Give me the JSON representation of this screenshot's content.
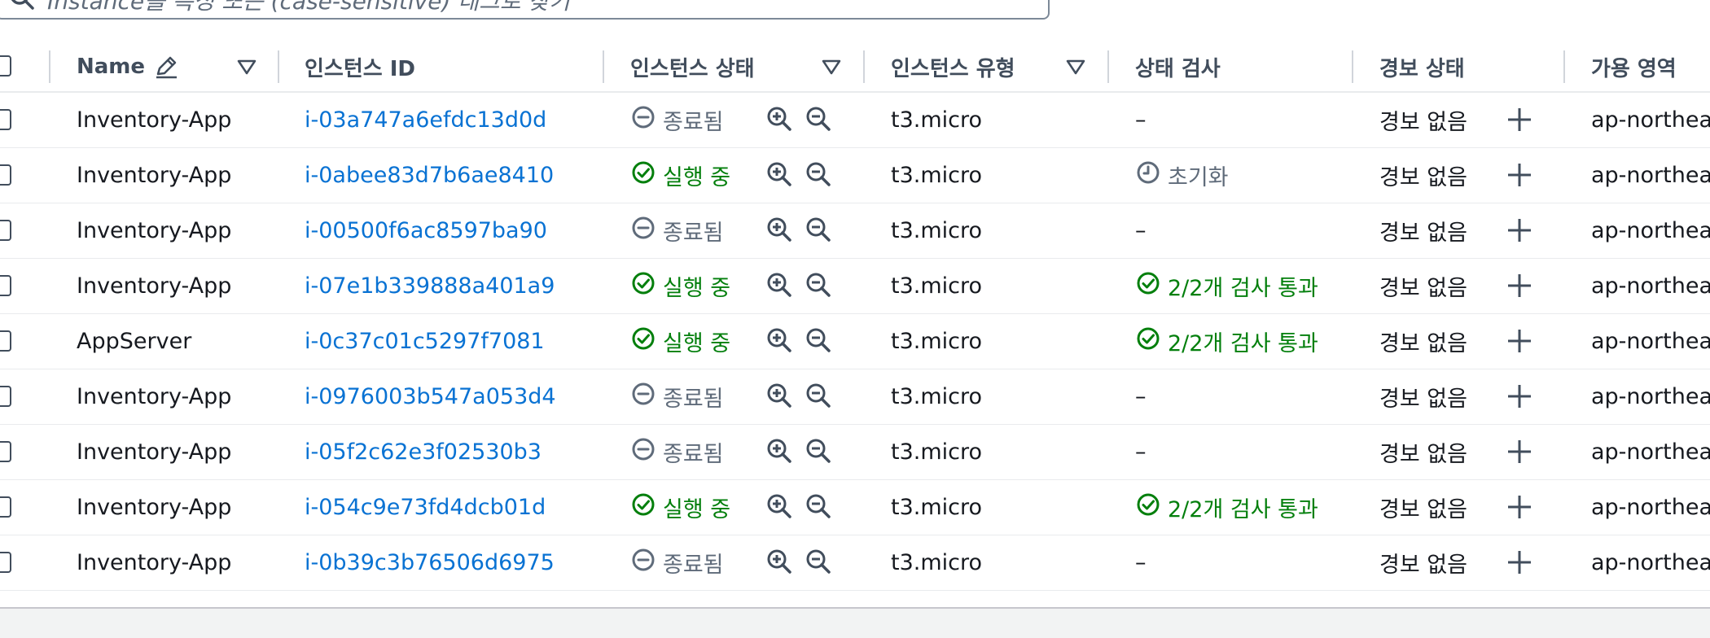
{
  "search": {
    "placeholder": "Instance를 특성 또는 (case-sensitive) 태그로 찾기"
  },
  "columns": {
    "name": "Name",
    "instance_id": "인스턴스 ID",
    "instance_state": "인스턴스 상태",
    "instance_type": "인스턴스 유형",
    "status_check": "상태 검사",
    "alarm_status": "경보 상태",
    "availability_zone": "가용 영역"
  },
  "colors": {
    "link": "#0972d3",
    "running": "#037f0c",
    "terminated": "#5f6b7a"
  },
  "rows": [
    {
      "name": "Inventory-App",
      "id": "i-03a747a6efdc13d0d",
      "state": "종료됨",
      "state_kind": "terminated",
      "type": "t3.micro",
      "check": "–",
      "check_kind": "none",
      "alarm": "경보 없음",
      "az": "ap-northeas"
    },
    {
      "name": "Inventory-App",
      "id": "i-0abee83d7b6ae8410",
      "state": "실행 중",
      "state_kind": "running",
      "type": "t3.micro",
      "check": "초기화",
      "check_kind": "pending",
      "alarm": "경보 없음",
      "az": "ap-northeas"
    },
    {
      "name": "Inventory-App",
      "id": "i-00500f6ac8597ba90",
      "state": "종료됨",
      "state_kind": "terminated",
      "type": "t3.micro",
      "check": "–",
      "check_kind": "none",
      "alarm": "경보 없음",
      "az": "ap-northeas"
    },
    {
      "name": "Inventory-App",
      "id": "i-07e1b339888a401a9",
      "state": "실행 중",
      "state_kind": "running",
      "type": "t3.micro",
      "check": "2/2개 검사 통과",
      "check_kind": "passed",
      "alarm": "경보 없음",
      "az": "ap-northeas"
    },
    {
      "name": "AppServer",
      "id": "i-0c37c01c5297f7081",
      "state": "실행 중",
      "state_kind": "running",
      "type": "t3.micro",
      "check": "2/2개 검사 통과",
      "check_kind": "passed",
      "alarm": "경보 없음",
      "az": "ap-northeas"
    },
    {
      "name": "Inventory-App",
      "id": "i-0976003b547a053d4",
      "state": "종료됨",
      "state_kind": "terminated",
      "type": "t3.micro",
      "check": "–",
      "check_kind": "none",
      "alarm": "경보 없음",
      "az": "ap-northeas"
    },
    {
      "name": "Inventory-App",
      "id": "i-05f2c62e3f02530b3",
      "state": "종료됨",
      "state_kind": "terminated",
      "type": "t3.micro",
      "check": "–",
      "check_kind": "none",
      "alarm": "경보 없음",
      "az": "ap-northeas"
    },
    {
      "name": "Inventory-App",
      "id": "i-054c9e73fd4dcb01d",
      "state": "실행 중",
      "state_kind": "running",
      "type": "t3.micro",
      "check": "2/2개 검사 통과",
      "check_kind": "passed",
      "alarm": "경보 없음",
      "az": "ap-northeas"
    },
    {
      "name": "Inventory-App",
      "id": "i-0b39c3b76506d6975",
      "state": "종료됨",
      "state_kind": "terminated",
      "type": "t3.micro",
      "check": "–",
      "check_kind": "none",
      "alarm": "경보 없음",
      "az": "ap-northeas"
    }
  ]
}
